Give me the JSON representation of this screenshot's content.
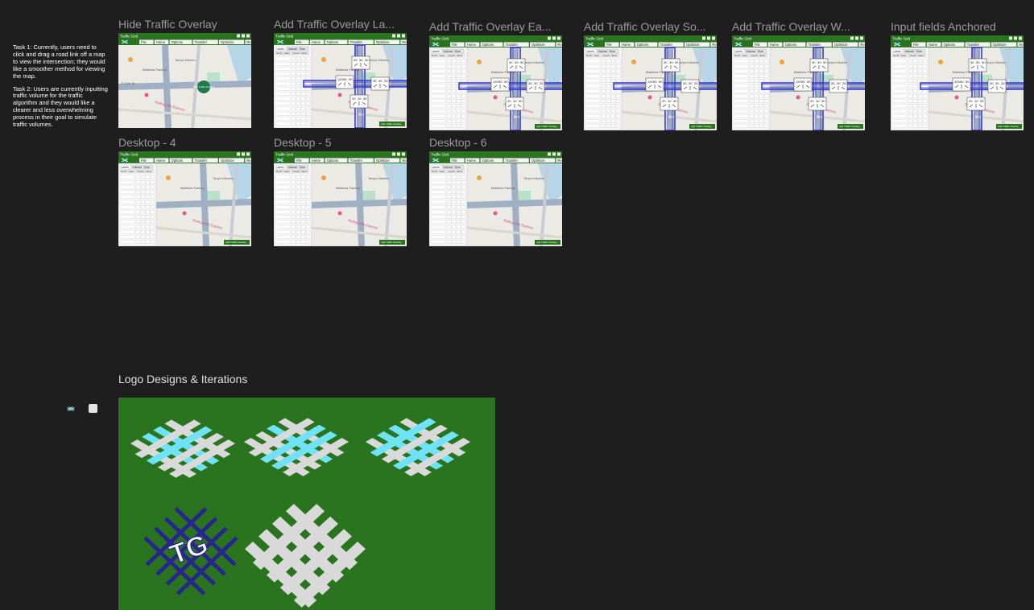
{
  "canvas": {
    "task_notes": [
      "Task 1: Currently, users need to click and drag a road link off a map to view the intersection; they would like a smoother method for viewing the map.",
      "Task 2: Users are currently inputting traffic volume for the traffic algorithm and they would like a clearer and less overwhelming process in their goal to simulate traffic volumes."
    ],
    "frames": [
      {
        "title": "Hide Traffic Overlay"
      },
      {
        "title": "Add Traffic Overlay La..."
      },
      {
        "title": "Add Traffic Overlay Ea..."
      },
      {
        "title": "Add Traffic Overlay So..."
      },
      {
        "title": "Add Traffic Overlay W..."
      },
      {
        "title": "Input fields Anchored"
      },
      {
        "title": "Desktop - 4"
      },
      {
        "title": "Desktop - 5"
      },
      {
        "title": "Desktop - 6"
      }
    ],
    "logo_section": {
      "title": "Logo Designs & Iterations",
      "logo_text": "TG"
    }
  },
  "app_mockup": {
    "app_name": "Traffic Grid",
    "menu": [
      "File",
      "Home",
      "Options",
      "Transfer",
      "Optimize",
      "Reports",
      "Help"
    ],
    "tabs": [
      "Lanes",
      "Volume",
      "Time"
    ],
    "directions": [
      "North",
      "East",
      "South",
      "West"
    ],
    "overlay_button": "Add Traffic Overlay",
    "hide_button": "Hide Traffic Overlay",
    "map_labels": [
      "Tony's Kitchen",
      "Mattress Factory",
      "Rolling Hills Express",
      "E 21st St"
    ],
    "volume_values": [
      "30",
      "30",
      "30",
      "120",
      "50",
      "90",
      "30",
      "40",
      "25",
      "20",
      "10"
    ]
  },
  "colors": {
    "background": "#1e1e1e",
    "title_bar": "#2a7420",
    "logo_board": "#2a7420",
    "accent_cyan": "#6fe3f5",
    "road_blue": "#3c3ccc",
    "logo_navy": "#27268c"
  }
}
